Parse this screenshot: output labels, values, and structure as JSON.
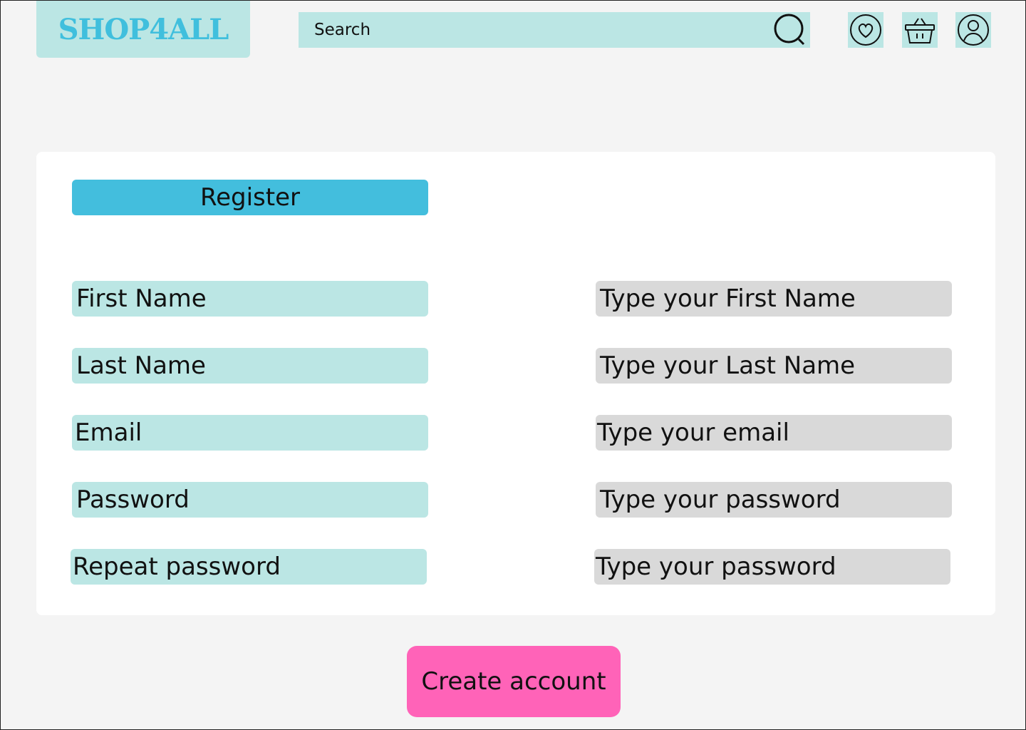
{
  "header": {
    "logo_text": "SHOP4ALL",
    "search_placeholder": "Search",
    "icons": [
      "search-icon",
      "heart-icon",
      "basket-icon",
      "user-icon"
    ]
  },
  "form": {
    "title": "Register",
    "fields": [
      {
        "label": "First Name",
        "placeholder": "Type your First Name"
      },
      {
        "label": "Last Name",
        "placeholder": "Type your Last Name"
      },
      {
        "label": "Email",
        "placeholder": "Type your email"
      },
      {
        "label": "Password",
        "placeholder": "Type your password"
      },
      {
        "label": "Repeat password",
        "placeholder": "Type your password"
      }
    ],
    "submit_label": "Create account"
  },
  "colors": {
    "background": "#f4f4f4",
    "card": "#ffffff",
    "logo_text": "#40bfdd",
    "light_teal": "#bbe6e4",
    "register_blue": "#43bedd",
    "input_gray": "#d9d9d9",
    "create_pink": "#ff63b8"
  }
}
